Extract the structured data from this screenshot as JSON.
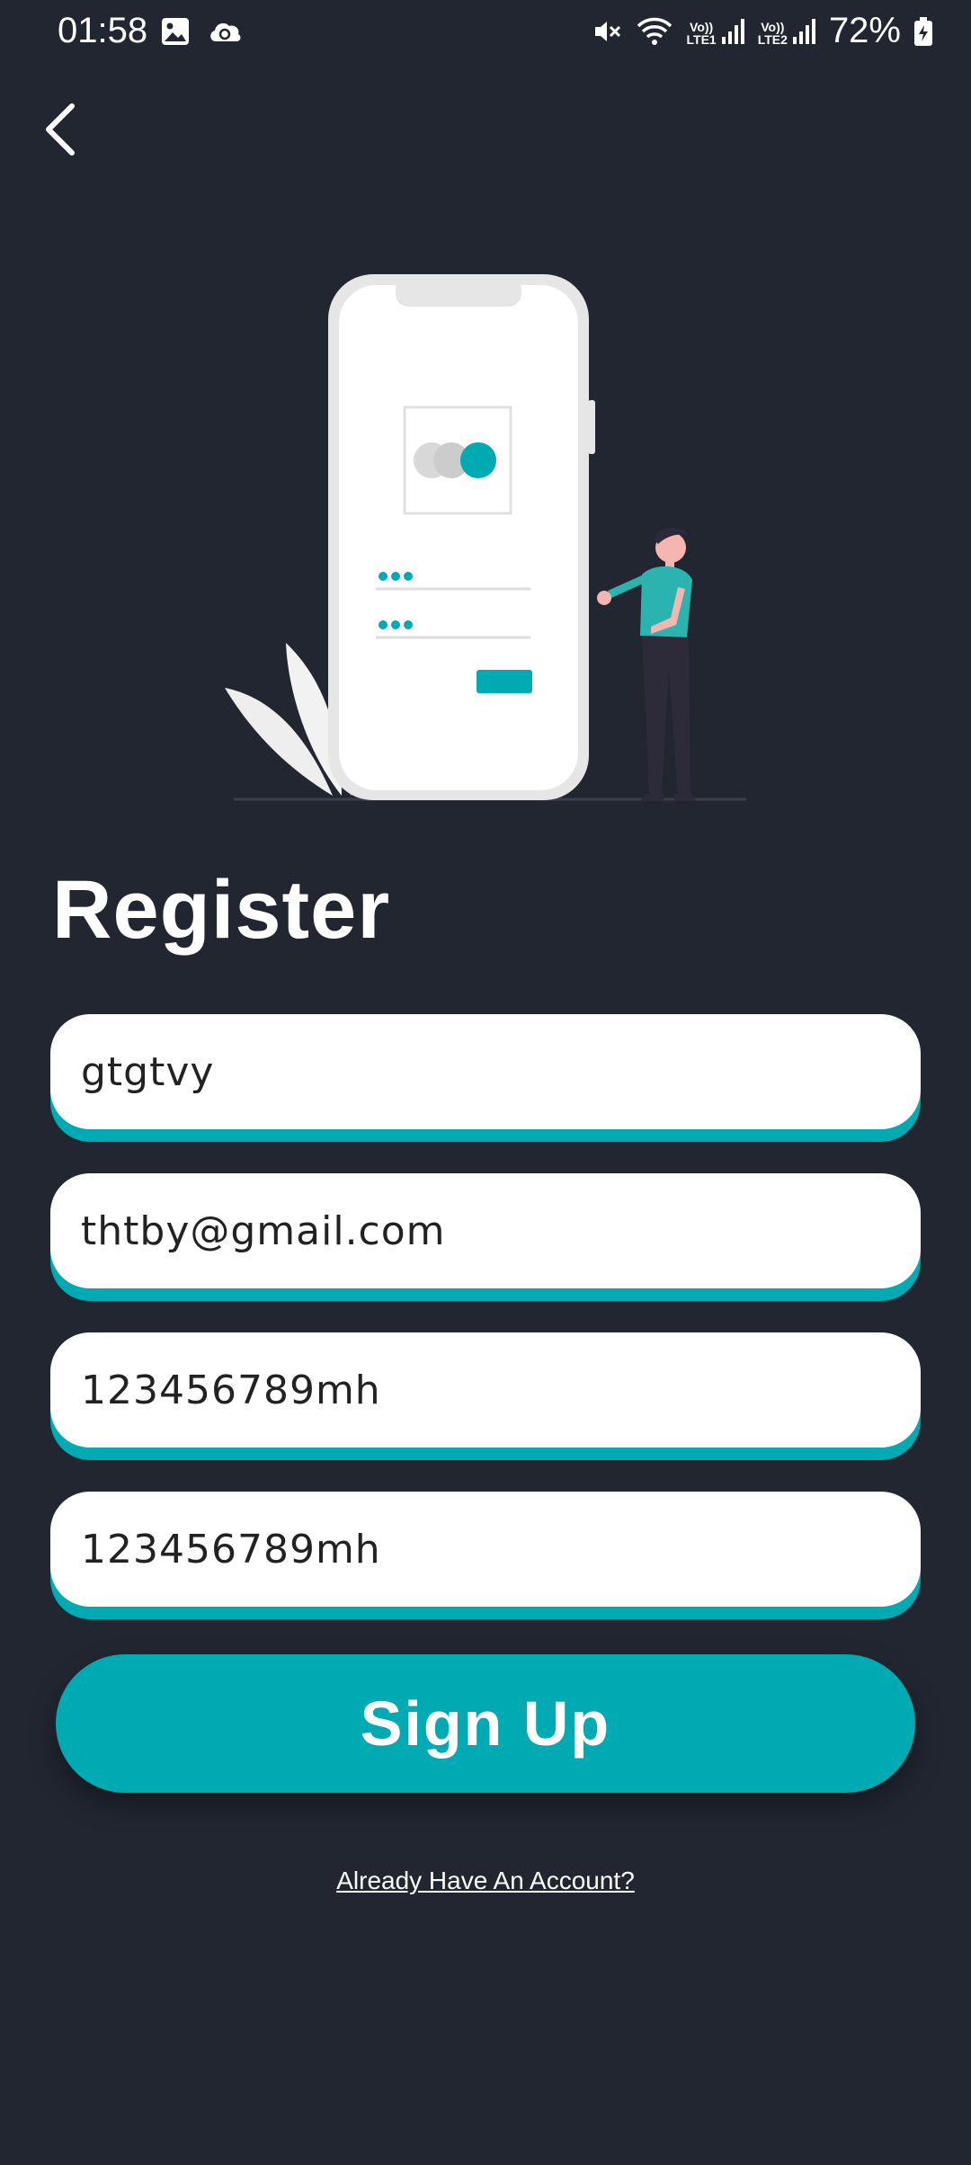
{
  "status_bar": {
    "time": "01:58",
    "left_icons": [
      "gallery-icon",
      "cloud-sync-icon"
    ],
    "right_icons": [
      "mute-icon",
      "wifi-icon",
      "signal-sim1-icon",
      "signal-sim2-icon",
      "battery-icon"
    ],
    "sim1_label_top": "Vo))",
    "sim1_label_bottom": "LTE1",
    "sim2_label_top": "Vo))",
    "sim2_label_bottom": "LTE2",
    "battery": "72%"
  },
  "navigation": {
    "back_icon": "chevron-left-icon"
  },
  "page": {
    "title": "Register"
  },
  "form": {
    "name_value": "gtgtvy",
    "email_value": "thtby@gmail.com",
    "password_value": "123456789mh",
    "confirm_password_value": "123456789mh",
    "submit_label": "Sign Up",
    "login_link": "Already Have An Account?"
  },
  "colors": {
    "background": "#212631",
    "accent": "#00aab2",
    "field_bg": "#ffffff"
  }
}
